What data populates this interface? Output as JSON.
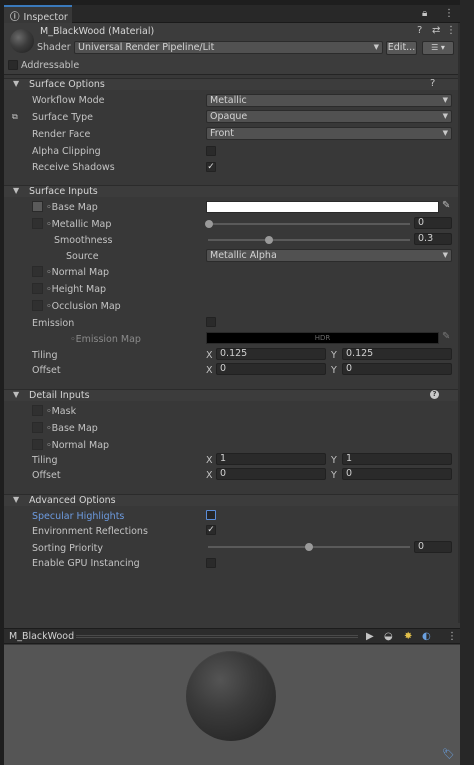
{
  "tab": {
    "title": "Inspector"
  },
  "header": {
    "material_name": "M_BlackWood (Material)",
    "shader_label": "Shader",
    "shader_value": "Universal Render Pipeline/Lit",
    "edit_label": "Edit...",
    "addressable_label": "Addressable"
  },
  "surface_options": {
    "title": "Surface Options",
    "workflow_label": "Workflow Mode",
    "workflow_value": "Metallic",
    "surface_type_label": "Surface Type",
    "surface_type_value": "Opaque",
    "render_face_label": "Render Face",
    "render_face_value": "Front",
    "alpha_clip_label": "Alpha Clipping",
    "receive_shadows_label": "Receive Shadows"
  },
  "surface_inputs": {
    "title": "Surface Inputs",
    "base_map": "Base Map",
    "metallic_map": "Metallic Map",
    "metallic_value": "0",
    "smoothness_label": "Smoothness",
    "smoothness_value": "0.3",
    "smoothness_fraction": 0.3,
    "source_label": "Source",
    "source_value": "Metallic Alpha",
    "normal_map": "Normal Map",
    "height_map": "Height Map",
    "occlusion_map": "Occlusion Map",
    "emission_label": "Emission",
    "emission_map": "Emission Map",
    "hdr_label": "HDR",
    "tiling_label": "Tiling",
    "tiling_x": "0.125",
    "tiling_y": "0.125",
    "offset_label": "Offset",
    "offset_x": "0",
    "offset_y": "0"
  },
  "detail_inputs": {
    "title": "Detail Inputs",
    "mask": "Mask",
    "base_map": "Base Map",
    "normal_map": "Normal Map",
    "tiling_label": "Tiling",
    "tiling_x": "1",
    "tiling_y": "1",
    "offset_label": "Offset",
    "offset_x": "0",
    "offset_y": "0"
  },
  "advanced_options": {
    "title": "Advanced Options",
    "specular_label": "Specular Highlights",
    "env_refl_label": "Environment Reflections",
    "sorting_label": "Sorting Priority",
    "sorting_value": "0",
    "gpu_label": "Enable GPU Instancing"
  },
  "axis": {
    "x": "X",
    "y": "Y"
  },
  "preview": {
    "name": "M_BlackWood"
  },
  "colors": {
    "accent": "#3a79bb",
    "link": "#6d9be0"
  }
}
